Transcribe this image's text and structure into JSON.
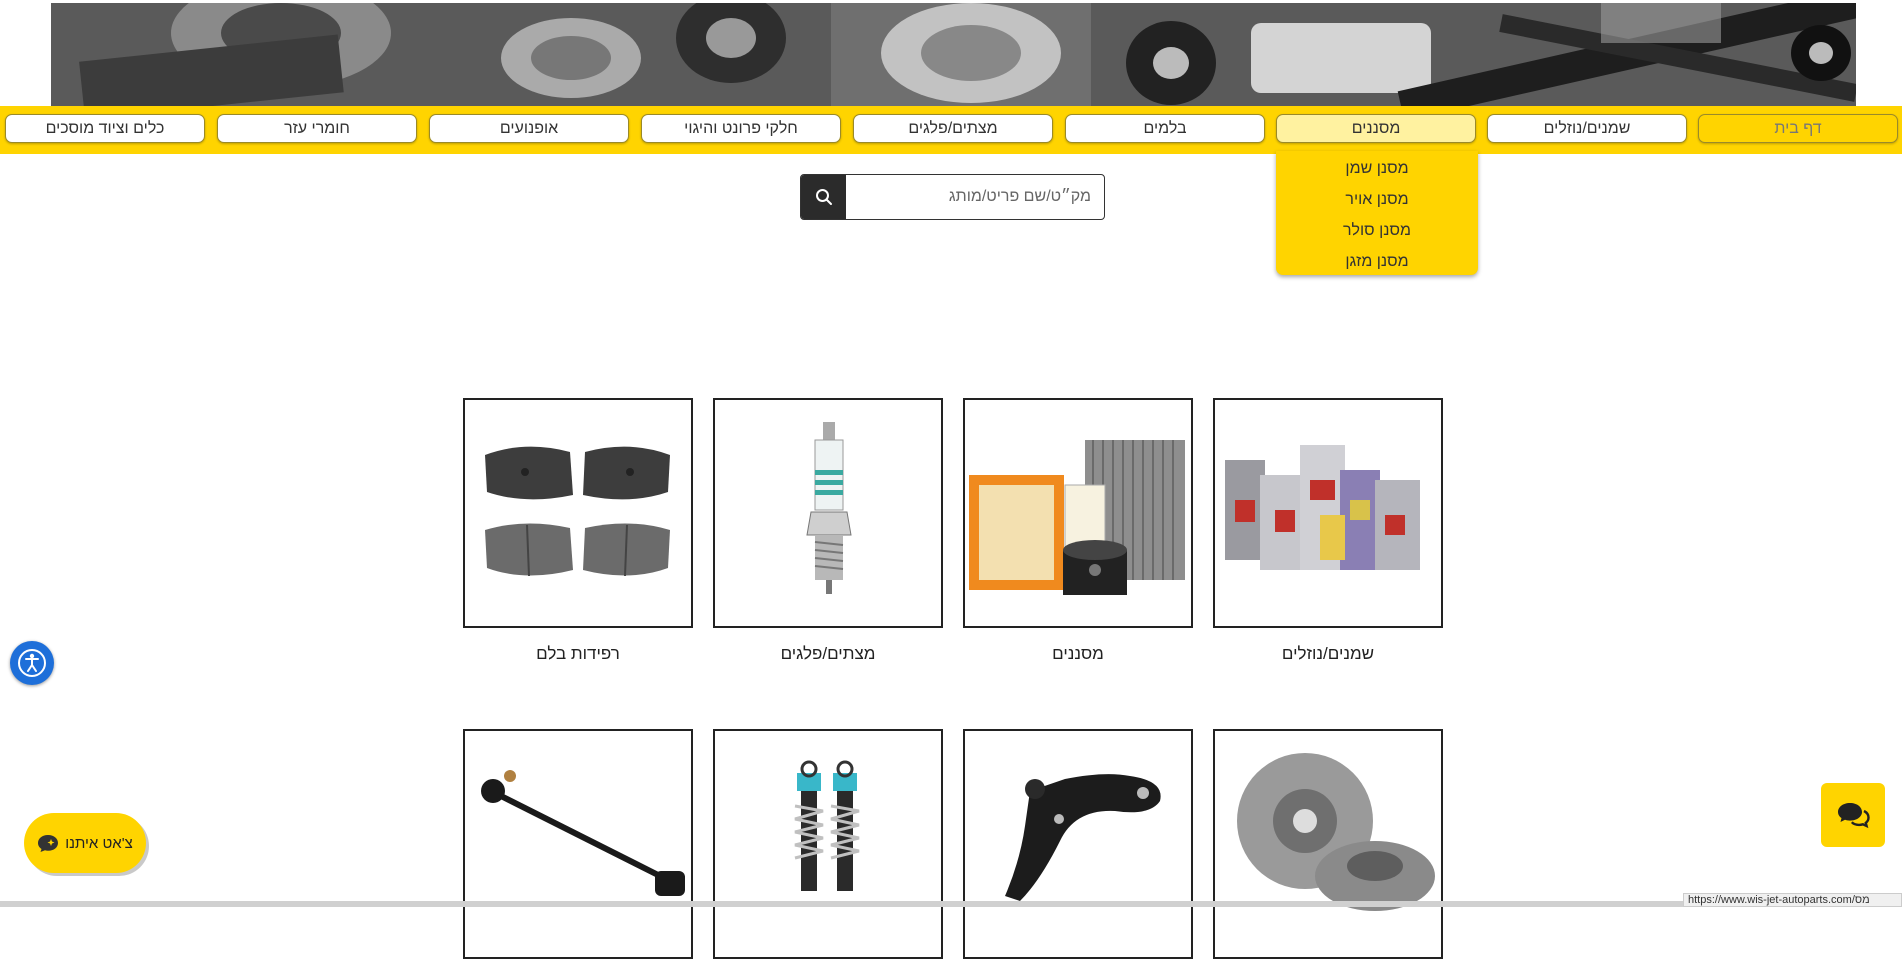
{
  "nav": {
    "items": [
      {
        "label": "דף בית",
        "state": "active"
      },
      {
        "label": "שמנים/נוזלים",
        "state": ""
      },
      {
        "label": "מסננים",
        "state": "open"
      },
      {
        "label": "בלמים",
        "state": ""
      },
      {
        "label": "מצתים/פלגים",
        "state": ""
      },
      {
        "label": "חלקי פרונט והיגוי",
        "state": ""
      },
      {
        "label": "אופנועים",
        "state": ""
      },
      {
        "label": "חומרי עזר",
        "state": ""
      },
      {
        "label": "כלים וציוד מוסכים",
        "state": ""
      }
    ]
  },
  "dropdown": {
    "items": [
      "מסנן שמן",
      "מסנן אויר",
      "מסנן סולר",
      "מסנן מזגן"
    ]
  },
  "search": {
    "placeholder": "מק״ט/שם פריט/מותג",
    "icon": "search-icon"
  },
  "categories": {
    "row1": [
      {
        "label": "שמנים/נוזלים",
        "image": "oil-bottles"
      },
      {
        "label": "מסננים",
        "image": "filters"
      },
      {
        "label": "מצתים/פלגים",
        "image": "spark-plug"
      },
      {
        "label": "רפידות בלם",
        "image": "brake-pads"
      }
    ],
    "row2": [
      {
        "label": "",
        "image": "brake-disc"
      },
      {
        "label": "",
        "image": "control-arm"
      },
      {
        "label": "",
        "image": "shock-absorbers"
      },
      {
        "label": "",
        "image": "stabilizer-link"
      }
    ]
  },
  "chat": {
    "label": "צ'אט איתנו"
  },
  "status_url": "https://www.wis-jet-autoparts.com/מס",
  "colors": {
    "accent": "#ffd400",
    "a11y": "#1e6fd9",
    "dark": "#2b2b2b"
  }
}
